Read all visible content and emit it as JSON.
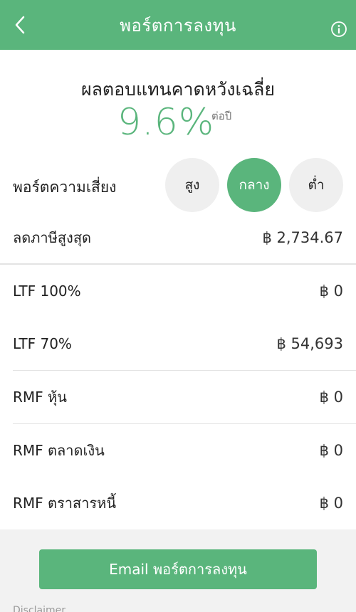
{
  "header": {
    "title": "พอร์ตการลงทุน",
    "back_icon": "chevron-left-icon",
    "info_icon": "info-icon"
  },
  "expected_return": {
    "label": "ผลตอบแทนคาดหวังเฉลี่ย",
    "value": "9.6%",
    "unit": "ต่อปี"
  },
  "risk": {
    "label": "พอร์ตความเสี่ยง",
    "options": [
      "สูง",
      "กลาง",
      "ต่ำ"
    ],
    "selected": "กลาง"
  },
  "tax": {
    "label": "ลดภาษีสูงสุด",
    "value": "฿ 2,734.67"
  },
  "funds": [
    {
      "label": "LTF 100%",
      "value": "฿ 0"
    },
    {
      "label": "LTF 70%",
      "value": "฿ 54,693"
    },
    {
      "label": "RMF หุ้น",
      "value": "฿ 0"
    },
    {
      "label": "RMF ตลาดเงิน",
      "value": "฿ 0"
    },
    {
      "label": "RMF ตราสารหนี้",
      "value": "฿ 0"
    }
  ],
  "email_button": "Email พอร์ตการลงทุน",
  "disclaimer": "Disclaimer",
  "colors": {
    "accent": "#5ab57c",
    "inactive_circle": "#efefef",
    "footer_bg": "#f2f2f2"
  }
}
